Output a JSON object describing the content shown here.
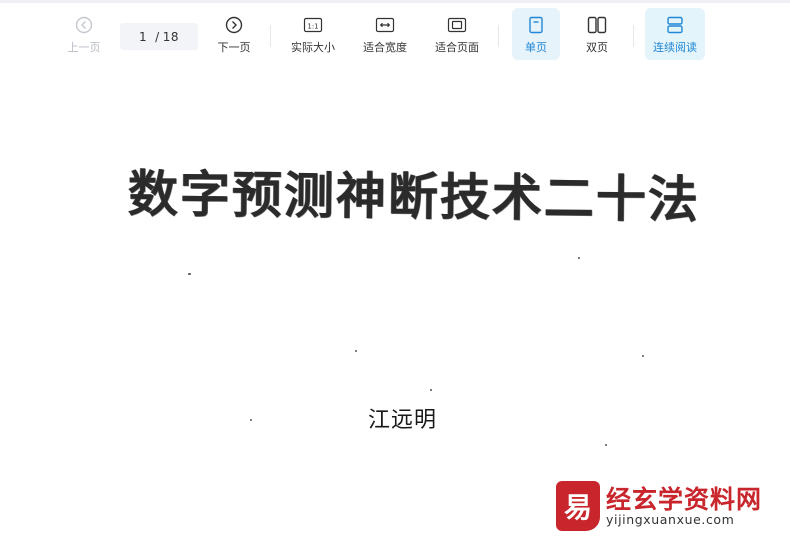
{
  "toolbar": {
    "prev_label": "上一页",
    "page_current": "1",
    "page_total": "18",
    "next_label": "下一页",
    "actual_size_label": "实际大小",
    "fit_width_label": "适合宽度",
    "fit_page_label": "适合页面",
    "single_page_label": "单页",
    "double_page_label": "双页",
    "continuous_label": "连续阅读",
    "active_color": "#2187d6",
    "actual_size_icon_text": "1:1"
  },
  "document": {
    "title": "数字预测神断技术二十法",
    "author": "江远明"
  },
  "watermark": {
    "logo_glyph": "易",
    "site_name": "经玄学资料网",
    "url": "yijingxuanxue.com",
    "brand_color": "#c8262c"
  }
}
